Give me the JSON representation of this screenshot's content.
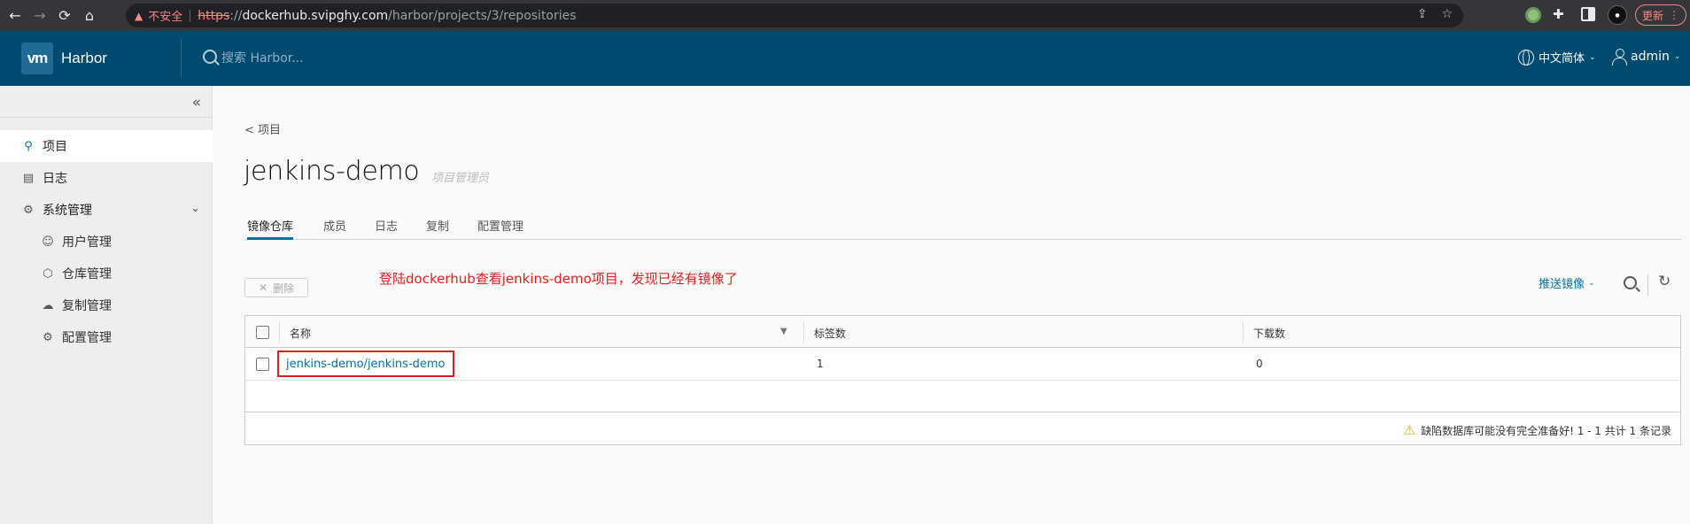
{
  "browser": {
    "insecure_label": "不安全",
    "url_protocol": "https",
    "url_separator": "://",
    "url_host": "dockerhub.svipghy.com",
    "url_path": "/harbor/projects/3/repositories",
    "update_label": "更新"
  },
  "header": {
    "logo_text": "vm",
    "app_name": "Harbor",
    "search_placeholder": "搜索 Harbor...",
    "language": "中文简体",
    "user": "admin"
  },
  "sidebar": {
    "items": [
      {
        "label": "项目",
        "icon": "projects-icon"
      },
      {
        "label": "日志",
        "icon": "logs-icon"
      },
      {
        "label": "系统管理",
        "icon": "admin-icon"
      }
    ],
    "sub_items": [
      {
        "label": "用户管理",
        "icon": "users-icon"
      },
      {
        "label": "仓库管理",
        "icon": "registry-icon"
      },
      {
        "label": "复制管理",
        "icon": "replication-icon"
      },
      {
        "label": "配置管理",
        "icon": "config-icon"
      }
    ]
  },
  "main": {
    "back_link": "< 项目",
    "project_name": "jenkins-demo",
    "role": "项目管理员",
    "tabs": [
      "镜像仓库",
      "成员",
      "日志",
      "复制",
      "配置管理"
    ],
    "delete_label": "删除",
    "annotation": "登陆dockerhub查看jenkins-demo项目，发现已经有镜像了",
    "push_label": "推送镜像"
  },
  "table": {
    "headers": [
      "名称",
      "标签数",
      "下载数"
    ],
    "rows": [
      {
        "name": "jenkins-demo/jenkins-demo",
        "tags": "1",
        "pulls": "0"
      }
    ],
    "footer": "缺陷数据库可能没有完全准备好! 1 - 1 共计 1 条记录"
  },
  "colors": {
    "header_bg": "#004a70",
    "accent": "#0072a3",
    "annotation": "#e02020"
  }
}
